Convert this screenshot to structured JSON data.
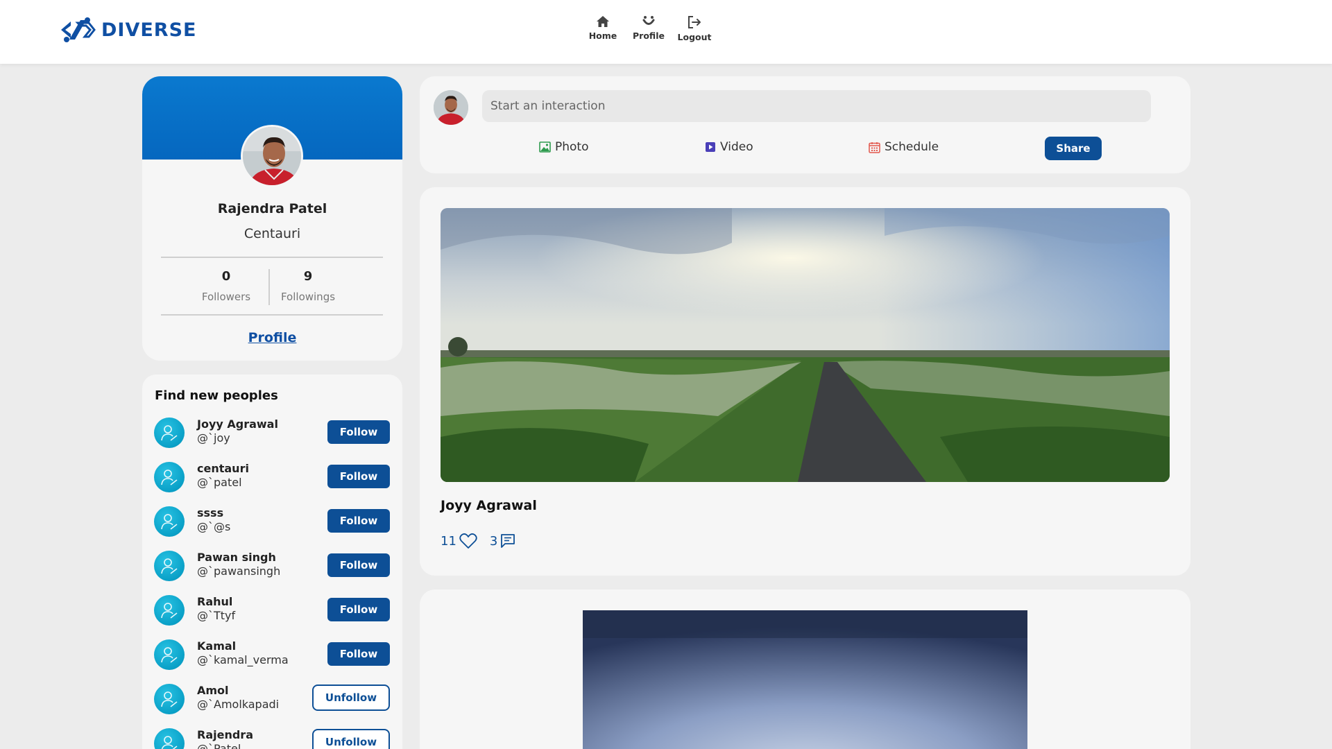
{
  "brand": {
    "name": "DIVERSE",
    "color": "#0f4fa3"
  },
  "nav": [
    {
      "label": "Home",
      "icon": "home-icon"
    },
    {
      "label": "Profile",
      "icon": "profile-icon"
    },
    {
      "label": "Logout",
      "icon": "logout-icon"
    }
  ],
  "profile": {
    "name": "Rajendra Patel",
    "handle": "Centauri",
    "followers_count": "0",
    "followers_label": "Followers",
    "followings_count": "9",
    "followings_label": "Followings",
    "link_label": "Profile"
  },
  "people": {
    "title": "Find new peoples",
    "items": [
      {
        "name": "Joyy Agrawal",
        "handle": "@`joy",
        "action": "Follow"
      },
      {
        "name": "centauri",
        "handle": "@`patel",
        "action": "Follow"
      },
      {
        "name": "ssss",
        "handle": "@`@s",
        "action": "Follow"
      },
      {
        "name": "Pawan singh",
        "handle": "@`pawansingh",
        "action": "Follow"
      },
      {
        "name": "Rahul",
        "handle": "@`Ttyf",
        "action": "Follow"
      },
      {
        "name": "Kamal",
        "handle": "@`kamal_verma",
        "action": "Follow"
      },
      {
        "name": "Amol",
        "handle": "@`Amolkapadi",
        "action": "Unfollow"
      },
      {
        "name": "Rajendra",
        "handle": "@`Patel",
        "action": "Unfollow"
      }
    ]
  },
  "composer": {
    "placeholder": "Start an interaction",
    "photo_label": "Photo",
    "video_label": "Video",
    "schedule_label": "Schedule",
    "share_label": "Share"
  },
  "posts": [
    {
      "author": "Joyy Agrawal",
      "likes": "11",
      "comments": "3"
    }
  ],
  "colors": {
    "primary": "#0d4f96",
    "banner": "#0567bf",
    "background": "#ececec",
    "card": "#f6f6f6"
  }
}
